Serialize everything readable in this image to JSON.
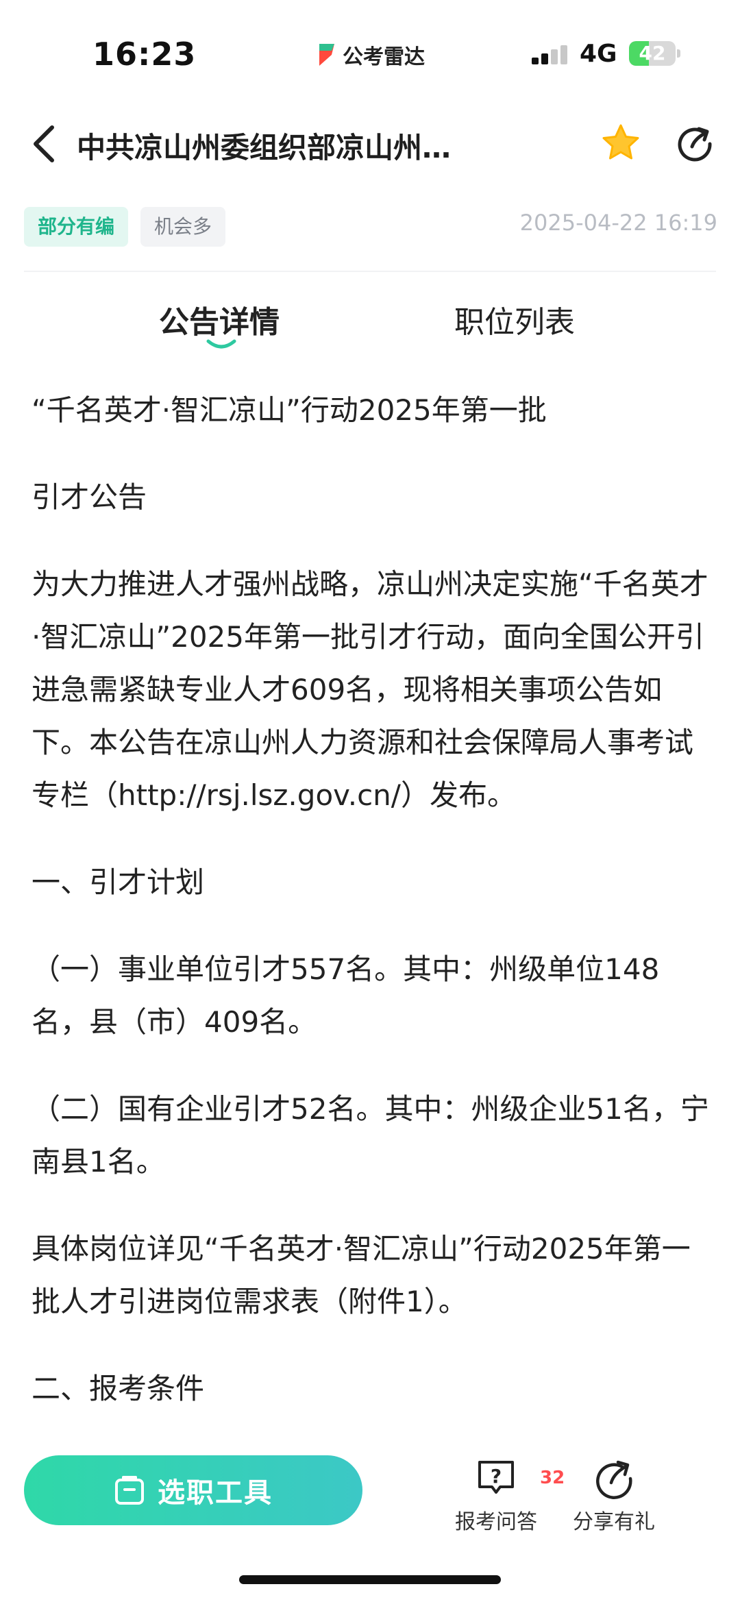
{
  "status_bar": {
    "time": "16:23",
    "app_name": "公考雷达",
    "network": "4G",
    "battery": "42",
    "battery_level_percent": 42
  },
  "header": {
    "title": "中共凉山州委组织部凉山州…"
  },
  "tags": [
    "部分有编",
    "机会多"
  ],
  "publish_time": "2025-04-22 16:19",
  "tabs": [
    "公告详情",
    "职位列表"
  ],
  "content": {
    "paragraphs": [
      "“千名英才·智汇凉山”行动2025年第一批",
      "引才公告",
      "为大力推进人才强州战略，凉山州决定实施“千名英才·智汇凉山”2025年第一批引才行动，面向全国公开引进急需紧缺专业人才609名，现将相关事项公告如下。本公告在凉山州人力资源和社会保障局人事考试专栏（http://rsj.lsz.gov.cn/）发布。",
      "一、引才计划",
      "（一）事业单位引才557名。其中：州级单位148名，县（市）409名。",
      "（二）国有企业引才52名。其中：州级企业51名，宁南县1名。",
      "具体岗位详见“千名英才·智汇凉山”行动2025年第一批人才引进岗位需求表（附件1）。",
      "二、报考条件"
    ]
  },
  "bottom_bar": {
    "primary_button": "选职工具",
    "qa_label": "报考问答",
    "qa_badge": "32",
    "share_label": "分享有礼"
  },
  "colors": {
    "accent": "#2fd8a8",
    "tag_green_text": "#1fb58c",
    "star": "#ffc52e",
    "badge": "#ff4d4f"
  },
  "icons": {
    "back": "chevron-left-icon",
    "favorite": "star-icon",
    "share": "share-icon",
    "tool": "bag-icon",
    "qa": "question-bubble-icon"
  }
}
